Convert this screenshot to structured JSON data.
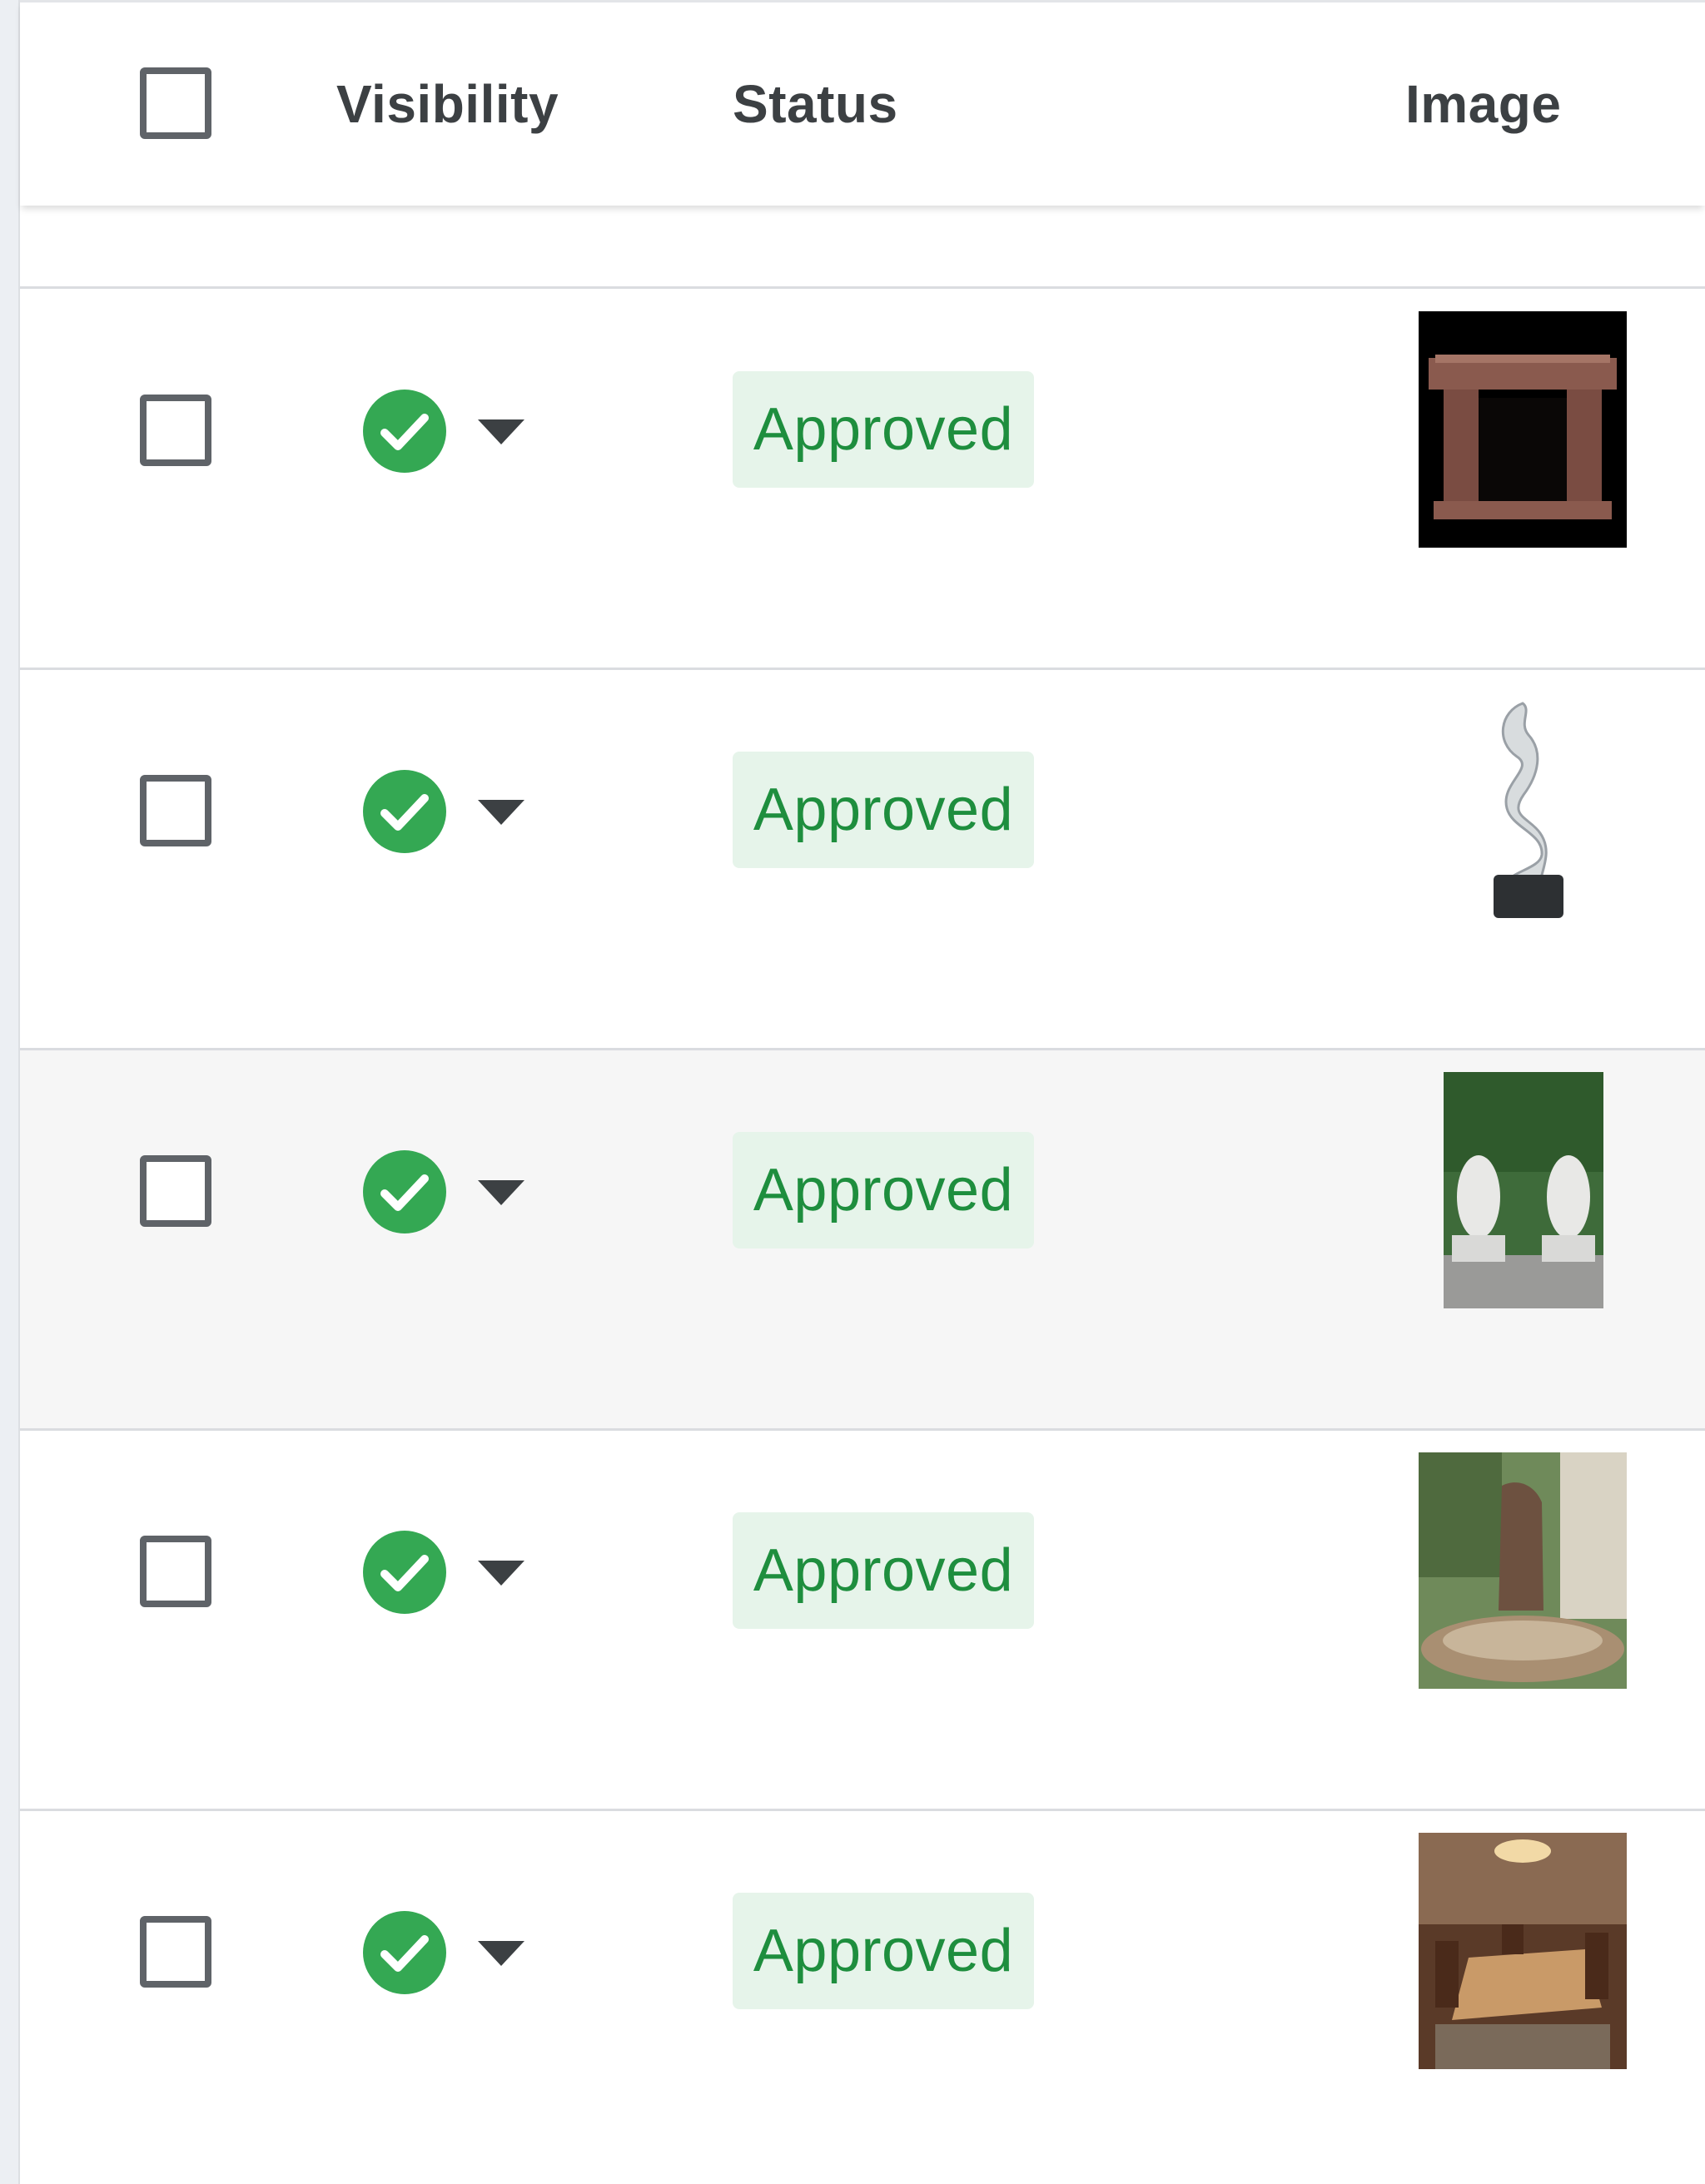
{
  "table": {
    "columns": {
      "visibility": "Visibility",
      "status": "Status",
      "image": "Image"
    },
    "rows": [
      {
        "status": "Approved",
        "visibility_icon": "check-circle-icon",
        "image_icon": "fireplace-mantel-icon"
      },
      {
        "status": "Approved",
        "visibility_icon": "check-circle-icon",
        "image_icon": "abstract-sculpture-icon"
      },
      {
        "status": "Approved",
        "visibility_icon": "check-circle-icon",
        "image_icon": "lion-statues-icon"
      },
      {
        "status": "Approved",
        "visibility_icon": "check-circle-icon",
        "image_icon": "garden-fountain-icon"
      },
      {
        "status": "Approved",
        "visibility_icon": "check-circle-icon",
        "image_icon": "dining-room-icon"
      }
    ]
  },
  "colors": {
    "approved_text": "#1e8e3e",
    "approved_bg": "#e6f4ea",
    "check_green": "#34a853",
    "header_text": "#3c4043"
  }
}
